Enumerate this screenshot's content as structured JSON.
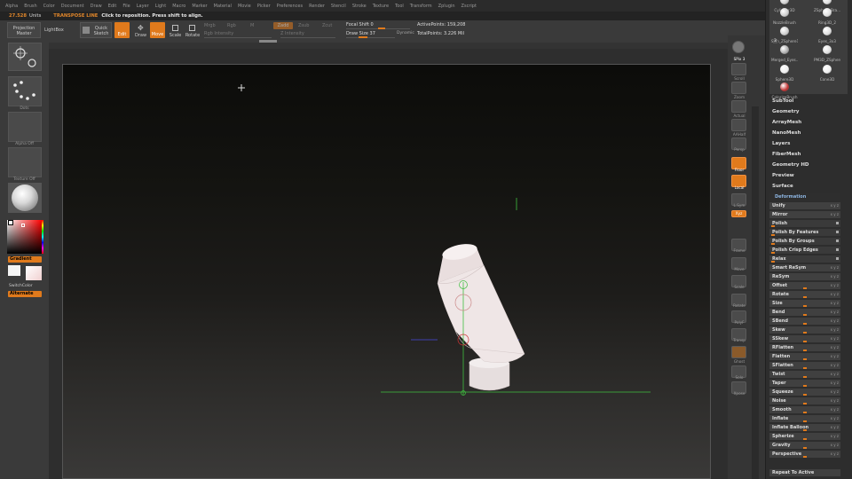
{
  "menu": [
    "Alpha",
    "Brush",
    "Color",
    "Document",
    "Draw",
    "Edit",
    "File",
    "Layer",
    "Light",
    "Macro",
    "Marker",
    "Material",
    "Movie",
    "Picker",
    "Preferences",
    "Render",
    "Stencil",
    "Stroke",
    "Texture",
    "Tool",
    "Transform",
    "Zplugin",
    "Zscript"
  ],
  "notice": {
    "units_value": "27.528",
    "units_label": "Units",
    "mode": "TRANSPOSE LINE",
    "message": "Click to reposition. Press shift to align."
  },
  "toolbar": {
    "projection_master": "Projection Master",
    "lightbox": "LightBox",
    "quick_sketch": "Quick Sketch",
    "edit": "Edit",
    "draw": "Draw",
    "move": "Move",
    "scale": "Scale",
    "rotate": "Rotate",
    "mrgb": "Mrgb",
    "rgb": "Rgb",
    "m": "M",
    "zadd": "Zadd",
    "zsub": "Zsub",
    "zcut": "Zcut",
    "rgb_intensity": "Rgb Intensity",
    "z_intensity": "Z Intensity",
    "focal_shift_label": "Focal Shift",
    "focal_shift_value": "0",
    "draw_size_label": "Draw Size",
    "draw_size_value": "37",
    "dynamic": "Dynamic",
    "active_points": "ActivePoints: 159,208",
    "total_points": "TotalPoints: 3.226 Mil"
  },
  "leftshelf": {
    "stroke_label": "Dots",
    "alpha_label": "Alpha Off",
    "texture_label": "Texture Off",
    "gradient": "Gradient",
    "switchcolor": "SwitchColor",
    "alternate": "Alternate"
  },
  "rightshelf": [
    "SPix",
    "Scroll",
    "Zoom",
    "Actual",
    "AAHalf",
    "Persp",
    "Floor",
    "Local",
    "L.Sym",
    "Xyz",
    "Frame",
    "Move",
    "Scale",
    "Rotate",
    "PolyF",
    "Transp",
    "Ghost",
    "Solo",
    "Xpose"
  ],
  "rightshelf_values": {
    "spix": "3"
  },
  "tools": [
    {
      "name": "Cylinder3D"
    },
    {
      "name": "ZSphere Bra..."
    },
    {
      "name": "NozzleBrush"
    },
    {
      "name": "Ring3D_2"
    },
    {
      "name": "Skin_ZSphere1"
    },
    {
      "name": "Eyes_3x3"
    },
    {
      "name": "Merged_Eyes..."
    },
    {
      "name": "PM3D_ZSphere3"
    },
    {
      "name": "Sphere3D"
    },
    {
      "name": "Cone3D"
    },
    {
      "name": "ColorizeBrush"
    }
  ],
  "tool_badges": {
    "merged_count": "3"
  },
  "tool_menu": [
    "SubTool",
    "Geometry",
    "ArrayMesh",
    "NanoMesh",
    "Layers",
    "FiberMesh",
    "Geometry HD",
    "Preview",
    "Surface"
  ],
  "deformation": {
    "header": "Deformation",
    "unify": "Unify",
    "mirror": "Mirror",
    "rows": [
      {
        "label": "Polish",
        "value": 0.05
      },
      {
        "label": "Polish By Features",
        "value": 0.05
      },
      {
        "label": "Polish By Groups",
        "value": 0.05
      },
      {
        "label": "Polish Crisp Edges",
        "value": 0.05
      },
      {
        "label": "Relax",
        "value": 0.05
      },
      {
        "label": "Smart ReSym",
        "value": null
      },
      {
        "label": "ReSym",
        "value": null
      },
      {
        "label": "Offset",
        "value": 0.5
      },
      {
        "label": "Rotate",
        "value": 0.5
      },
      {
        "label": "Size",
        "value": 0.5
      },
      {
        "label": "Bend",
        "value": 0.5
      },
      {
        "label": "SBend",
        "value": 0.5
      },
      {
        "label": "Skew",
        "value": 0.5
      },
      {
        "label": "SSkew",
        "value": 0.5
      },
      {
        "label": "RFlatten",
        "value": 0.5
      },
      {
        "label": "Flatten",
        "value": 0.5
      },
      {
        "label": "SFlatten",
        "value": 0.5
      },
      {
        "label": "Twist",
        "value": 0.5
      },
      {
        "label": "Taper",
        "value": 0.5
      },
      {
        "label": "Squeeze",
        "value": 0.5
      },
      {
        "label": "Noise",
        "value": 0.5
      },
      {
        "label": "Smooth",
        "value": 0.5
      },
      {
        "label": "Inflate",
        "value": 0.5
      },
      {
        "label": "Inflate Balloon",
        "value": 0.5
      },
      {
        "label": "Spherize",
        "value": 0.5
      },
      {
        "label": "Gravity",
        "value": 0.5
      },
      {
        "label": "Perspective",
        "value": 0.5
      }
    ],
    "repeat_to_active": "Repeat To Active"
  },
  "colors": {
    "accent": "#e07a1c",
    "transpose_line": "#3fbf3f",
    "axis_blue": "#4a4adf",
    "axis_red": "#cc3333"
  }
}
